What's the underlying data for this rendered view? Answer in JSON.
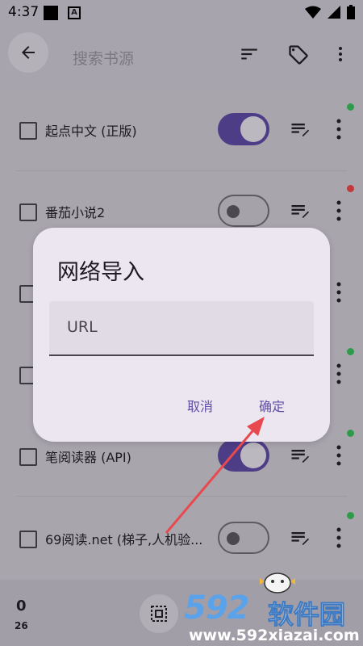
{
  "status_bar": {
    "time": "4:37",
    "notification_icons": [
      "square-icon",
      "a-icon"
    ],
    "system_icons": [
      "wifi-icon",
      "signal-icon",
      "battery-icon"
    ]
  },
  "toolbar": {
    "search_placeholder": "搜索书源",
    "icons": [
      "back-icon",
      "sort-icon",
      "tag-icon",
      "more-icon"
    ]
  },
  "sources": [
    {
      "name": "起点中文 (正版)",
      "enabled": true,
      "status_color": "#2e9b4b"
    },
    {
      "name": "番茄小说2",
      "enabled": false,
      "status_color": "#c0393b"
    },
    {
      "name": "",
      "enabled": false,
      "status_color": ""
    },
    {
      "name": "",
      "enabled": false,
      "status_color": "#2e9b4b"
    },
    {
      "name": "笔阅读器 (API)",
      "enabled": true,
      "status_color": "#2e9b4b"
    },
    {
      "name": "69阅读.net (梯子,人机验...",
      "enabled": false,
      "status_color": "#2e9b4b"
    }
  ],
  "bottom_bar": {
    "selected_count": "0",
    "total_count": "26"
  },
  "dialog": {
    "title": "网络导入",
    "url_placeholder": "URL",
    "url_value": "",
    "cancel_label": "取消",
    "confirm_label": "确定"
  },
  "watermark": {
    "brand": "592",
    "cn_text": "软件园",
    "url": "www.592xiazai.com"
  },
  "colors": {
    "accent": "#5f4ea5",
    "switch_on": "#4d3d87",
    "dialog_bg": "#ece6f0",
    "annotation_arrow": "#e8494f"
  }
}
